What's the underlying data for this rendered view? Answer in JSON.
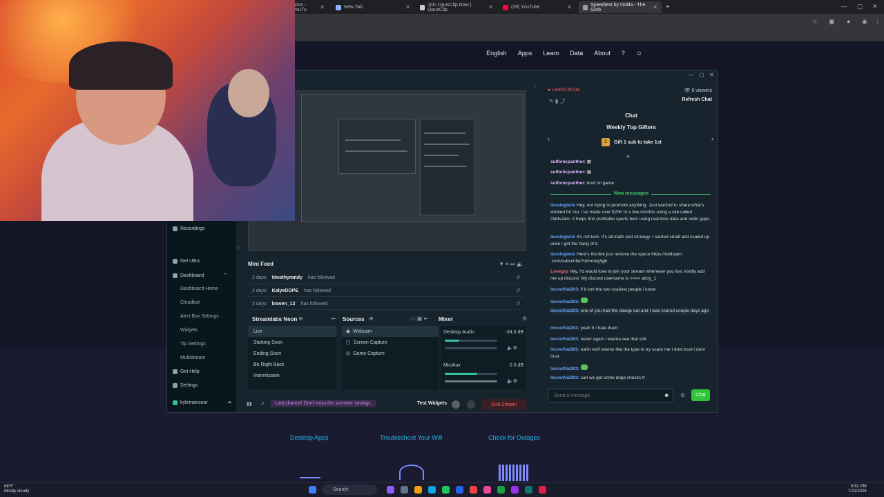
{
  "browser": {
    "tabs": [
      {
        "label": "ation - YouTu",
        "active": false
      },
      {
        "label": "New Tab",
        "active": false
      },
      {
        "label": "Join OpusClip Now | OpusClip",
        "active": false
      },
      {
        "label": "(39) YouTube",
        "active": false
      },
      {
        "label": "Speedtest by Ookla - The Glob",
        "active": true
      }
    ]
  },
  "speedtest": {
    "nav": [
      "English",
      "Apps",
      "Learn",
      "Data",
      "About"
    ],
    "links": [
      "Desktop Apps",
      "Troubleshoot Your Wifi",
      "Check for Outages"
    ]
  },
  "streamlabs": {
    "sidebar": {
      "recordings": "Recordings",
      "get_ultra": "Get Ultra",
      "dashboard": "Dashboard",
      "dashboard_items": [
        "Dashboard Home",
        "Cloudbot",
        "Alert Box Settings",
        "Widgets",
        "Tip Settings",
        "Multistream"
      ],
      "get_help": "Get Help",
      "settings": "Settings",
      "user": "kylemansoor"
    },
    "mini_feed": {
      "title": "Mini Feed",
      "rows": [
        {
          "time": "2 days",
          "user": "timothyrandy",
          "action": "has followed"
        },
        {
          "time": "2 days",
          "user": "KalyeDOPE",
          "action": "has followed"
        },
        {
          "time": "3 days",
          "user": "bowen_12",
          "action": "has followed"
        }
      ]
    },
    "scenes": {
      "title": "Streamlabs Neon",
      "items": [
        "Live",
        "Starting Soon",
        "Ending Soon",
        "Be Right Back",
        "Intermission"
      ]
    },
    "sources": {
      "title": "Sources",
      "items": [
        "Webcam",
        "Screen Capture",
        "Game Capture"
      ]
    },
    "mixer": {
      "title": "Mixer",
      "channels": [
        {
          "name": "Desktop Audio",
          "db": "-34.0 dB",
          "level": 0.28
        },
        {
          "name": "Mic/Aux",
          "db": "0.0 dB",
          "level": 0.62
        }
      ]
    },
    "footer": {
      "promo": "Last chance! Don't miss the summer savings.",
      "test_widgets": "Test Widgets",
      "end_stream": "End Stream"
    }
  },
  "chat": {
    "live_label": "Live",
    "timer": "00:30:08",
    "viewers": "9 viewers",
    "refresh": "Refresh Chat",
    "title": "Chat",
    "top_gifters_title": "Weekly Top Gifters",
    "gifter_rank": "1",
    "gifter_text": "Gift 1 sub to take 1st",
    "new_messages": "New messages",
    "messages": [
      {
        "user": "sulfonicpanther:",
        "text": "",
        "style": "u2"
      },
      {
        "user": "sulfonicpanther:",
        "text": "",
        "style": "u2"
      },
      {
        "user": "sulfonicpanther:",
        "text": "boof sh game",
        "style": "u2"
      },
      {
        "user": "louslogistic",
        "text": "Hey, not trying to promote anything. Just wanted to share what's worked for me. I've made over $20K in a few months using a site called OddsJam. It helps find profitable sports bets using real-time data and odds gaps.",
        "style": "u"
      },
      {
        "user": "louslogistic",
        "text": "It's not luck. It's all math and strategy. I started small and scaled up once I got the hang of it.",
        "style": "u"
      },
      {
        "user": "louslogistic",
        "text": "Here's the link just remove the space https://oddsjam .com/subscribe?ref=nwq3yjk",
        "style": "u"
      },
      {
        "user": "Lovegrp",
        "text": "Hey, I'd would love to join your stream whenever you live, kindly add me up discord. My discord username is >>>> aboy_1",
        "style": "u3"
      },
      {
        "user": "IncredVal203:",
        "text": "if it isnt the two scariest people i know",
        "style": "u"
      },
      {
        "user": "IncredVal203:",
        "text": "",
        "style": "u"
      },
      {
        "user": "IncredVal203:",
        "text": "one of you had the dawgs out and I was scared couple days ago",
        "style": "u"
      },
      {
        "user": "IncredVal203:",
        "text": "yeah fr i hate them",
        "style": "u"
      },
      {
        "user": "IncredVal203:",
        "text": "never again i wanna see that shit",
        "style": "u"
      },
      {
        "user": "IncredVal203:",
        "text": "nahh wolf seems like the type to try scare me i dont trust i dont trust",
        "style": "u"
      },
      {
        "user": "IncredVal203:",
        "text": "",
        "style": "u"
      },
      {
        "user": "IncredVal203:",
        "text": "can we get some dripp checks fr",
        "style": "u"
      }
    ],
    "input_placeholder": "Send a message",
    "send_label": "Chat"
  },
  "taskbar": {
    "search": "Search",
    "weather": "68°F",
    "weather_sub": "Mostly cloudy",
    "time": "6:52 PM",
    "date": "7/21/2025"
  }
}
